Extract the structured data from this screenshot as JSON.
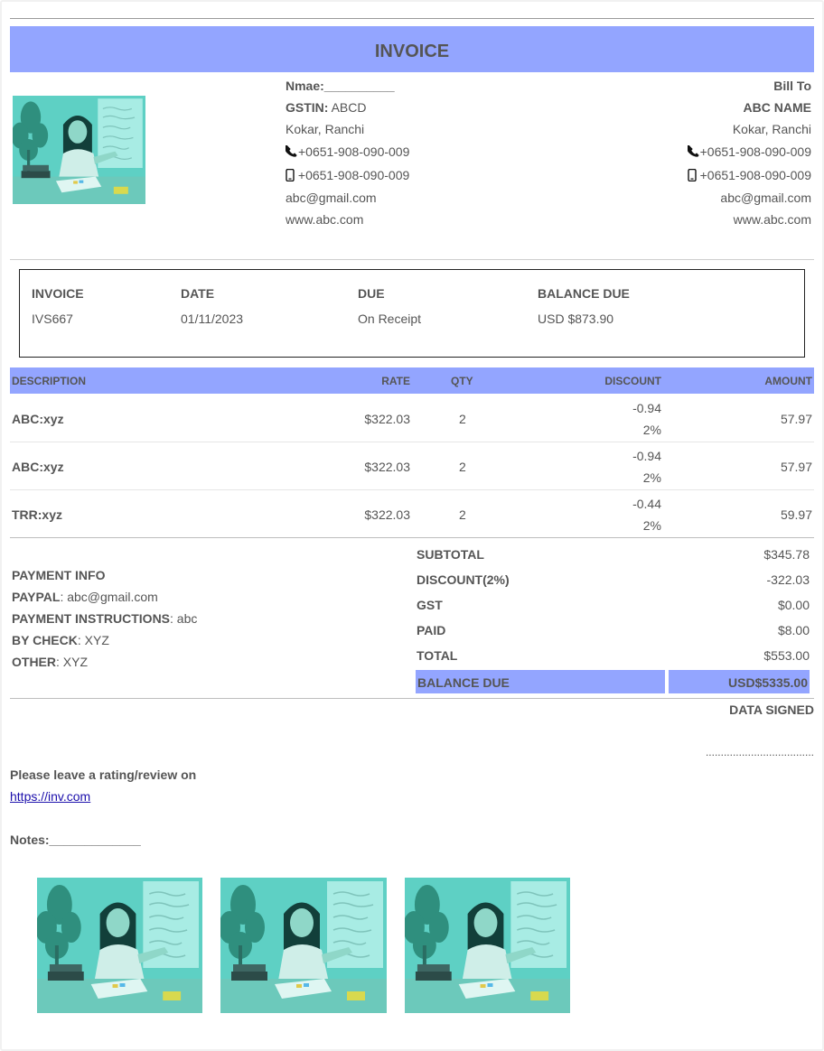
{
  "header": {
    "title": "INVOICE"
  },
  "seller": {
    "name_label": "Nmae:__________",
    "gstin_label": "GSTIN:",
    "gstin_value": " ABCD",
    "address": "Kokar, Ranchi",
    "phone": "+0651-908-090-009",
    "mobile": " +0651-908-090-009",
    "email": "abc@gmail.com",
    "website": "www.abc.com"
  },
  "buyer": {
    "heading": "Bill To",
    "name": "ABC NAME",
    "address": "Kokar, Ranchi",
    "phone": "+0651-908-090-009",
    "mobile": "+0651-908-090-009",
    "email": "abc@gmail.com",
    "website": "www.abc.com"
  },
  "meta": {
    "invoice_label": "INVOICE",
    "invoice_value": "IVS667",
    "date_label": "DATE",
    "date_value": "01/11/2023",
    "due_label": "DUE",
    "due_value": "On Receipt",
    "balance_label": "BALANCE DUE",
    "balance_value": "USD $873.90"
  },
  "items_header": {
    "description": "DESCRIPTION",
    "rate": "RATE",
    "qty": "QTY",
    "discount": "DISCOUNT",
    "amount": "AMOUNT"
  },
  "items": [
    {
      "description": "ABC:xyz",
      "rate": "$322.03",
      "qty": "2",
      "discount": "-0.94",
      "discount_pct": "2%",
      "amount": "57.97"
    },
    {
      "description": "ABC:xyz",
      "rate": "$322.03",
      "qty": "2",
      "discount": "-0.94",
      "discount_pct": "2%",
      "amount": "57.97"
    },
    {
      "description": "TRR:xyz",
      "rate": "$322.03",
      "qty": "2",
      "discount": "-0.44",
      "discount_pct": "2%",
      "amount": "59.97"
    }
  ],
  "payment": {
    "heading": "PAYMENT INFO",
    "paypal_label": "PAYPAL",
    "paypal_value": ": abc@gmail.com",
    "instructions_label": "PAYMENT INSTRUCTIONS",
    "instructions_value": ": abc",
    "check_label": "BY CHECK",
    "check_value": ": XYZ",
    "other_label": "OTHER",
    "other_value": ": XYZ"
  },
  "totals": {
    "subtotal_label": "SUBTOTAL",
    "subtotal_value": "$345.78",
    "discount_label": "DISCOUNT(2%)",
    "discount_value": "-322.03",
    "gst_label": "GST",
    "gst_value": "$0.00",
    "paid_label": "PAID",
    "paid_value": "$8.00",
    "total_label": "TOTAL",
    "total_value": "$553.00",
    "balance_label": "BALANCE DUE",
    "balance_value": "USD$5335.00"
  },
  "footer": {
    "signed": "DATA SIGNED",
    "signature_line": "....................................",
    "review_text": "Please leave a rating/review on",
    "review_link": "https://inv.com",
    "notes": "Notes:_____________"
  },
  "colors": {
    "accent": "#93a5ff",
    "text": "#555555",
    "photo_tint": "#5fd6c8"
  }
}
